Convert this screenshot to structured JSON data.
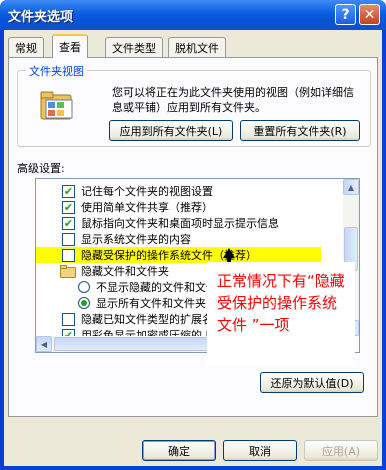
{
  "window": {
    "title": "文件夹选项"
  },
  "tabs": [
    {
      "label": "常规"
    },
    {
      "label": "查看"
    },
    {
      "label": "文件类型"
    },
    {
      "label": "脱机文件"
    }
  ],
  "folder_views": {
    "legend": "文件夹视图",
    "description": "您可以将正在为此文件夹使用的视图（例如详细信息或平铺）应用到所有文件夹。",
    "apply_all_label": "应用到所有文件夹(L)",
    "reset_all_label": "重置所有文件夹(R)"
  },
  "advanced": {
    "label": "高级设置:",
    "items": [
      {
        "type": "checkbox",
        "checked": true,
        "label": "记住每个文件夹的视图设置"
      },
      {
        "type": "checkbox",
        "checked": true,
        "label": "使用简单文件共享（推荐）"
      },
      {
        "type": "checkbox",
        "checked": true,
        "label": "鼠标指向文件夹和桌面项时显示提示信息"
      },
      {
        "type": "checkbox",
        "checked": false,
        "label": "显示系统文件夹的内容"
      },
      {
        "type": "checkbox",
        "checked": false,
        "label": "隐藏受保护的操作系统文件（推荐）",
        "highlighted": true
      },
      {
        "type": "folder",
        "label": "隐藏文件和文件夹"
      },
      {
        "type": "radio",
        "checked": false,
        "label": "不显示隐藏的文件和文件夹"
      },
      {
        "type": "radio",
        "checked": true,
        "label": "显示所有文件和文件夹"
      },
      {
        "type": "checkbox",
        "checked": false,
        "label": "隐藏已知文件类型的扩展名"
      },
      {
        "type": "checkbox",
        "checked": true,
        "label": "用彩色显示加密或压缩的 NTFS 文件"
      }
    ],
    "restore_label": "还原为默认值(D)"
  },
  "annotation": {
    "text": "正常情况下有“隐藏受保护的操作系统文件 ”一项"
  },
  "footer": {
    "ok_label": "确定",
    "cancel_label": "取消",
    "apply_label": "应用(A)"
  },
  "icons": {
    "help": "?",
    "close": "✕",
    "check": "✔",
    "scroll_up": "▲",
    "scroll_down": "▼",
    "scroll_left": "◀",
    "scroll_right": "▶"
  },
  "colors": {
    "title_bar": "#0b5ce0",
    "dialog_bg": "#ece9d8",
    "highlight": "#ffff00",
    "annotation_text": "#ff0000",
    "check": "#21a121"
  }
}
